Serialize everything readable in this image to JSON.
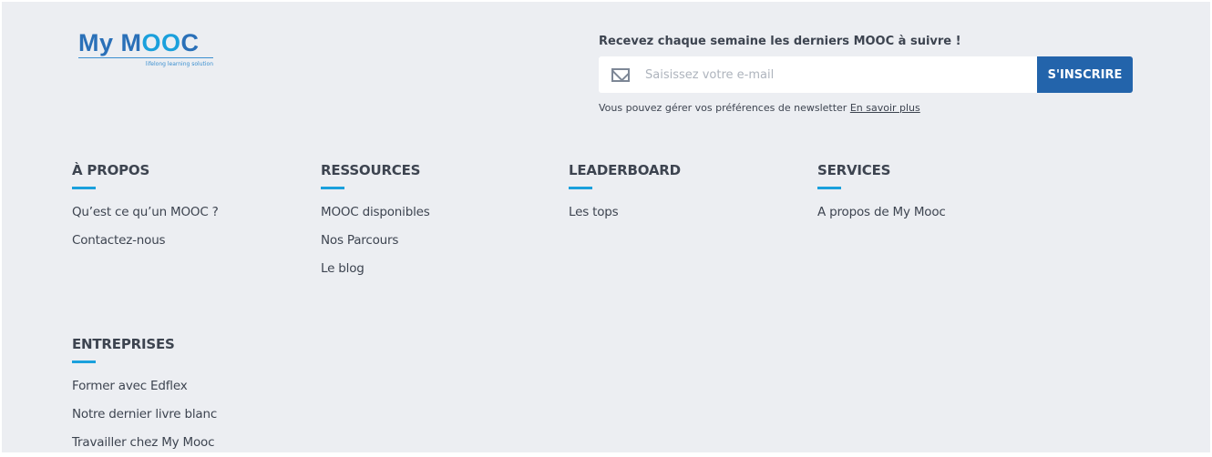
{
  "logo": {
    "name": "My MOOC",
    "word1": "My M",
    "word2": "OO",
    "word3": "C",
    "tagline": "lifelong learning solution"
  },
  "newsletter": {
    "title": "Recevez chaque semaine les derniers MOOC à suivre !",
    "placeholder": "Saisissez votre e-mail",
    "button": "S'INSCRIRE",
    "note": "Vous pouvez gérer vos préférences de newsletter",
    "link": "En savoir plus",
    "icon": "envelope-icon"
  },
  "columns": [
    {
      "title": "À PROPOS",
      "links": [
        "Qu’est ce qu’un MOOC ?",
        "Contactez-nous"
      ]
    },
    {
      "title": "RESSOURCES",
      "links": [
        "MOOC disponibles",
        "Nos Parcours",
        "Le blog"
      ]
    },
    {
      "title": "LEADERBOARD",
      "links": [
        "Les tops"
      ]
    },
    {
      "title": "SERVICES",
      "links": [
        "A propos de My Mooc"
      ]
    },
    {
      "title": "ENTREPRISES",
      "links": [
        "Former avec Edflex",
        "Notre dernier livre blanc",
        "Travailler chez My Mooc"
      ]
    }
  ],
  "colors": {
    "accent": "#1aa0dc",
    "button": "#2364ab",
    "background": "#eceef2"
  }
}
